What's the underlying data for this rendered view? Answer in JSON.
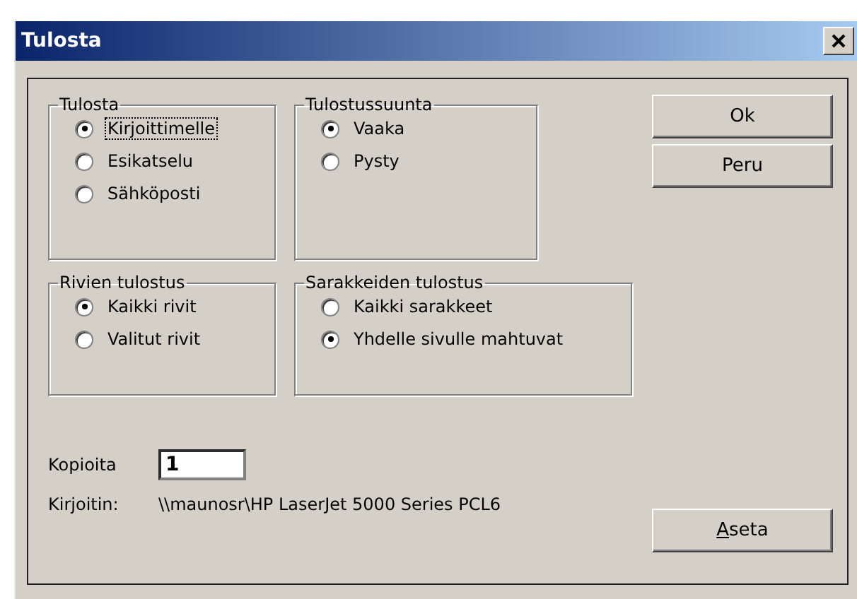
{
  "window": {
    "title": "Tulosta"
  },
  "groups": [
    {
      "title": "Tulosta",
      "options": [
        {
          "label": "Kirjoittimelle",
          "selected": true,
          "focused": true
        },
        {
          "label": "Esikatselu",
          "selected": false,
          "focused": false
        },
        {
          "label": "Sähköposti",
          "selected": false,
          "focused": false
        }
      ]
    },
    {
      "title": "Tulostussuunta",
      "options": [
        {
          "label": "Vaaka",
          "selected": true,
          "focused": false
        },
        {
          "label": "Pysty",
          "selected": false,
          "focused": false
        }
      ]
    },
    {
      "title": "Rivien tulostus",
      "options": [
        {
          "label": "Kaikki rivit",
          "selected": true,
          "focused": false
        },
        {
          "label": "Valitut rivit",
          "selected": false,
          "focused": false
        }
      ]
    },
    {
      "title": "Sarakkeiden tulostus",
      "options": [
        {
          "label": "Kaikki sarakkeet",
          "selected": false,
          "focused": false
        },
        {
          "label": "Yhdelle sivulle mahtuvat",
          "selected": true,
          "focused": false
        }
      ]
    }
  ],
  "buttons": [
    {
      "label": "Ok"
    },
    {
      "label": "Peru"
    }
  ],
  "copies": {
    "label": "Kopioita",
    "value": "1"
  },
  "printer": {
    "label": "Kirjoitin:",
    "value": "\\\\maunosr\\HP LaserJet 5000 Series PCL6"
  },
  "setup_button": {
    "mnemonic": "A",
    "label_rest": "seta"
  }
}
